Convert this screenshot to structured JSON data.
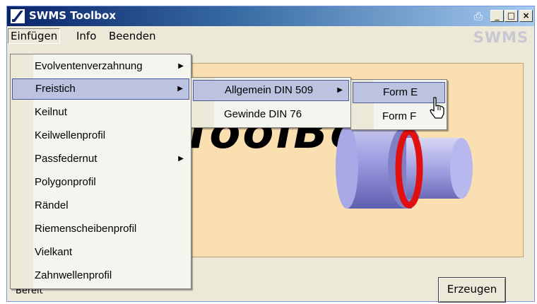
{
  "window": {
    "title": "SWMS Toolbox",
    "controls": {
      "print": "⎙",
      "minimize": "_",
      "maximize": "□",
      "close": "×"
    }
  },
  "menubar": {
    "items": [
      "Einfügen",
      "Info",
      "Beenden"
    ],
    "logo": "SWMS"
  },
  "content": {
    "background_text": "ToolBox",
    "status_text": "Bereit",
    "action_button": "Erzeugen"
  },
  "menu_einfuegen": {
    "items": [
      {
        "label": "Evolventenverzahnung",
        "has_submenu": true
      },
      {
        "label": "Freistich",
        "has_submenu": true,
        "selected": true
      },
      {
        "label": "Keilnut"
      },
      {
        "label": "Keilwellenprofil"
      },
      {
        "label": "Passfedernut",
        "has_submenu": true
      },
      {
        "label": "Polygonprofil"
      },
      {
        "label": "Rändel"
      },
      {
        "label": "Riemenscheibenprofil"
      },
      {
        "label": "Vielkant"
      },
      {
        "label": "Zahnwellenprofil"
      }
    ]
  },
  "menu_freistich": {
    "items": [
      {
        "label": "Allgemein DIN 509",
        "has_submenu": true,
        "selected": true
      },
      {
        "label": "Gewinde DIN 76"
      }
    ]
  },
  "menu_din509": {
    "items": [
      {
        "label": "Form E",
        "selected": true
      },
      {
        "label": "Form F"
      }
    ]
  },
  "colors": {
    "titlebar_start": "#0a246a",
    "titlebar_end": "#a6caf0",
    "panel_bg": "#fadfb0",
    "menu_highlight": "#bcc3e0",
    "part_red": "#e01010",
    "part_body": "#8f8fd6"
  }
}
